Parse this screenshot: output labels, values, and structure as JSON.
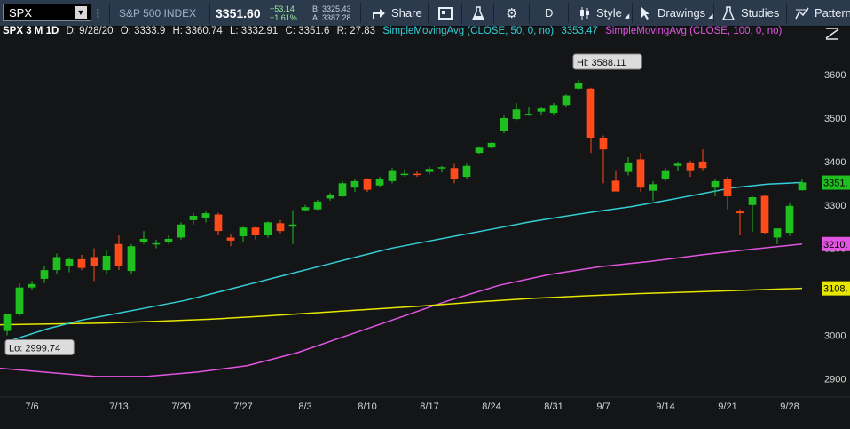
{
  "toolbar": {
    "symbol": "SPX",
    "name": "S&P 500 INDEX",
    "last": "3351.60",
    "change": "+53.14",
    "change_pct": "+1.61%",
    "bid": "B: 3325.43",
    "ask": "A: 3387.28",
    "share_label": "Share",
    "period_label": "D",
    "style_label": "Style",
    "drawings_label": "Drawings",
    "studies_label": "Studies",
    "patterns_label": "Patterns"
  },
  "infobar": {
    "title": "SPX 3 M 1D",
    "date": "D: 9/28/20",
    "open": "O: 3333.9",
    "high": "H: 3360.74",
    "low": "L: 3332.91",
    "close": "C: 3351.6",
    "range": "R: 27.83",
    "sma50_label": "SimpleMovingAvg (CLOSE, 50, 0, no)",
    "sma50_value": "3353.47",
    "sma100_label": "SimpleMovingAvg (CLOSE, 100, 0, no)"
  },
  "colors": {
    "background": "#131517",
    "up": "#1fbf1f",
    "down": "#ff4b1a",
    "sma50": "#33cfd6",
    "sma100": "#e255e2",
    "sma200": "#e6e600",
    "grid": "#2a2d30",
    "axis_text": "#d6d6d6"
  },
  "chart_data": {
    "type": "candlestick",
    "ylim": [
      2870,
      3680
    ],
    "y_ticks": [
      2900,
      3000,
      3100,
      3200,
      3300,
      3400,
      3500,
      3600
    ],
    "x_ticks": [
      "7/6",
      "7/13",
      "7/20",
      "7/27",
      "8/3",
      "8/10",
      "8/17",
      "8/24",
      "8/31",
      "9/7",
      "9/14",
      "9/21",
      "9/28"
    ],
    "x_tick_index": [
      2,
      9,
      14,
      19,
      24,
      29,
      34,
      39,
      44,
      48,
      53,
      58,
      63
    ],
    "hi_label": "Hi: 3588.11",
    "lo_label": "Lo: 2999.74",
    "price_labels": [
      {
        "text": "3351.",
        "value": 3351.6,
        "color": "#1fbf1f"
      },
      {
        "text": "3210.",
        "value": 3210,
        "color": "#e255e2"
      },
      {
        "text": "3108.",
        "value": 3108,
        "color": "#e6e600"
      }
    ],
    "candles": [
      {
        "o": 3010,
        "h": 3050,
        "l": 3000,
        "c": 3048
      },
      {
        "o": 3050,
        "h": 3120,
        "l": 3045,
        "c": 3110
      },
      {
        "o": 3110,
        "h": 3125,
        "l": 3105,
        "c": 3118
      },
      {
        "o": 3130,
        "h": 3160,
        "l": 3120,
        "c": 3150
      },
      {
        "o": 3150,
        "h": 3188,
        "l": 3140,
        "c": 3180
      },
      {
        "o": 3160,
        "h": 3180,
        "l": 3145,
        "c": 3175
      },
      {
        "o": 3175,
        "h": 3185,
        "l": 3150,
        "c": 3155
      },
      {
        "o": 3180,
        "h": 3200,
        "l": 3125,
        "c": 3160
      },
      {
        "o": 3150,
        "h": 3195,
        "l": 3140,
        "c": 3183
      },
      {
        "o": 3210,
        "h": 3230,
        "l": 3150,
        "c": 3160
      },
      {
        "o": 3148,
        "h": 3210,
        "l": 3140,
        "c": 3205
      },
      {
        "o": 3215,
        "h": 3240,
        "l": 3210,
        "c": 3222
      },
      {
        "o": 3210,
        "h": 3220,
        "l": 3200,
        "c": 3212
      },
      {
        "o": 3215,
        "h": 3230,
        "l": 3210,
        "c": 3222
      },
      {
        "o": 3225,
        "h": 3260,
        "l": 3220,
        "c": 3255
      },
      {
        "o": 3265,
        "h": 3282,
        "l": 3255,
        "c": 3275
      },
      {
        "o": 3270,
        "h": 3285,
        "l": 3260,
        "c": 3281
      },
      {
        "o": 3278,
        "h": 3282,
        "l": 3230,
        "c": 3240
      },
      {
        "o": 3225,
        "h": 3232,
        "l": 3205,
        "c": 3218
      },
      {
        "o": 3228,
        "h": 3250,
        "l": 3215,
        "c": 3248
      },
      {
        "o": 3248,
        "h": 3250,
        "l": 3220,
        "c": 3230
      },
      {
        "o": 3230,
        "h": 3262,
        "l": 3225,
        "c": 3260
      },
      {
        "o": 3258,
        "h": 3265,
        "l": 3235,
        "c": 3240
      },
      {
        "o": 3250,
        "h": 3288,
        "l": 3210,
        "c": 3255
      },
      {
        "o": 3288,
        "h": 3300,
        "l": 3285,
        "c": 3295
      },
      {
        "o": 3290,
        "h": 3312,
        "l": 3288,
        "c": 3308
      },
      {
        "o": 3315,
        "h": 3328,
        "l": 3310,
        "c": 3322
      },
      {
        "o": 3320,
        "h": 3355,
        "l": 3318,
        "c": 3350
      },
      {
        "o": 3340,
        "h": 3360,
        "l": 3330,
        "c": 3355
      },
      {
        "o": 3360,
        "h": 3362,
        "l": 3330,
        "c": 3335
      },
      {
        "o": 3345,
        "h": 3365,
        "l": 3340,
        "c": 3360
      },
      {
        "o": 3355,
        "h": 3385,
        "l": 3350,
        "c": 3380
      },
      {
        "o": 3372,
        "h": 3382,
        "l": 3365,
        "c": 3372
      },
      {
        "o": 3372,
        "h": 3378,
        "l": 3365,
        "c": 3371
      },
      {
        "o": 3376,
        "h": 3388,
        "l": 3370,
        "c": 3383
      },
      {
        "o": 3385,
        "h": 3390,
        "l": 3375,
        "c": 3387
      },
      {
        "o": 3385,
        "h": 3395,
        "l": 3350,
        "c": 3360
      },
      {
        "o": 3365,
        "h": 3395,
        "l": 3360,
        "c": 3390
      },
      {
        "o": 3420,
        "h": 3435,
        "l": 3418,
        "c": 3432
      },
      {
        "o": 3432,
        "h": 3445,
        "l": 3430,
        "c": 3443
      },
      {
        "o": 3470,
        "h": 3505,
        "l": 3465,
        "c": 3500
      },
      {
        "o": 3498,
        "h": 3535,
        "l": 3495,
        "c": 3520
      },
      {
        "o": 3510,
        "h": 3525,
        "l": 3505,
        "c": 3510
      },
      {
        "o": 3515,
        "h": 3525,
        "l": 3508,
        "c": 3522
      },
      {
        "o": 3512,
        "h": 3535,
        "l": 3508,
        "c": 3530
      },
      {
        "o": 3530,
        "h": 3555,
        "l": 3525,
        "c": 3552
      },
      {
        "o": 3568,
        "h": 3588,
        "l": 3566,
        "c": 3580
      },
      {
        "o": 3568,
        "h": 3570,
        "l": 3420,
        "c": 3455
      },
      {
        "o": 3455,
        "h": 3460,
        "l": 3350,
        "c": 3428
      },
      {
        "o": 3356,
        "h": 3380,
        "l": 3335,
        "c": 3331
      },
      {
        "o": 3376,
        "h": 3410,
        "l": 3368,
        "c": 3398
      },
      {
        "o": 3405,
        "h": 3420,
        "l": 3330,
        "c": 3340
      },
      {
        "o": 3333,
        "h": 3355,
        "l": 3310,
        "c": 3348
      },
      {
        "o": 3360,
        "h": 3385,
        "l": 3355,
        "c": 3380
      },
      {
        "o": 3390,
        "h": 3400,
        "l": 3378,
        "c": 3395
      },
      {
        "o": 3398,
        "h": 3402,
        "l": 3365,
        "c": 3380
      },
      {
        "o": 3400,
        "h": 3428,
        "l": 3380,
        "c": 3385
      },
      {
        "o": 3340,
        "h": 3360,
        "l": 3320,
        "c": 3355
      },
      {
        "o": 3360,
        "h": 3365,
        "l": 3290,
        "c": 3320
      },
      {
        "o": 3285,
        "h": 3290,
        "l": 3230,
        "c": 3281
      },
      {
        "o": 3300,
        "h": 3320,
        "l": 3238,
        "c": 3318
      },
      {
        "o": 3321,
        "h": 3323,
        "l": 3232,
        "c": 3236
      },
      {
        "o": 3225,
        "h": 3245,
        "l": 3210,
        "c": 3246
      },
      {
        "o": 3236,
        "h": 3306,
        "l": 3229,
        "c": 3298
      },
      {
        "o": 3334,
        "h": 3361,
        "l": 3333,
        "c": 3352
      }
    ],
    "sma50": [
      2990,
      3015,
      3035,
      3050,
      3065,
      3080,
      3100,
      3120,
      3140,
      3160,
      3180,
      3200,
      3215,
      3230,
      3245,
      3260,
      3273,
      3285,
      3296,
      3310,
      3325,
      3340,
      3348,
      3352
    ],
    "sma100": [
      2925,
      2915,
      2905,
      2905,
      2915,
      2930,
      2960,
      3000,
      3040,
      3080,
      3115,
      3140,
      3158,
      3170,
      3185,
      3198,
      3210
    ],
    "sma200": [
      3024,
      3026,
      3028,
      3032,
      3037,
      3044,
      3052,
      3060,
      3068,
      3077,
      3085,
      3091,
      3096,
      3100,
      3104,
      3108
    ]
  }
}
